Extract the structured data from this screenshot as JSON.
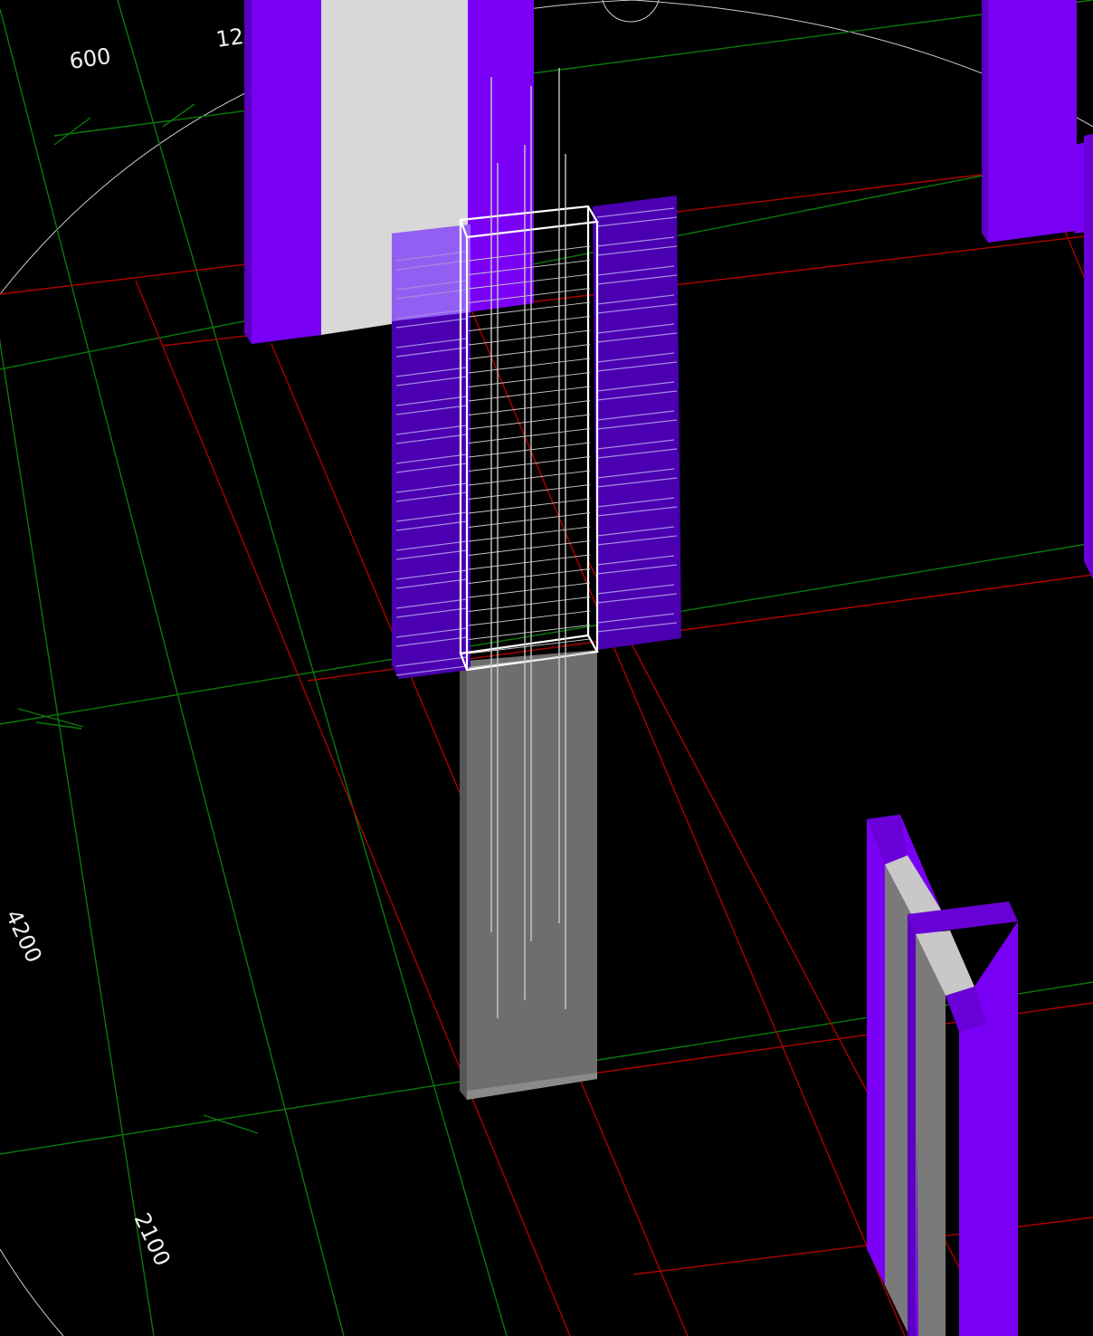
{
  "viewport": {
    "background": "#000000"
  },
  "colors": {
    "axis_grid": "#b00000",
    "span_grid": "#0a7a0a",
    "column_face": "#7a00f5",
    "column_shade": "#5a00c0",
    "column_core": "#d8d8d8",
    "pier": "#6e6e6e",
    "selection": "#ffffff",
    "rebar": "#c9c9c9",
    "tie": "#a48ae0"
  },
  "dimensions": {
    "d600": "600",
    "d12": "12",
    "d4200": "4200",
    "d2100": "2100"
  },
  "icons": {
    "orbit": "orbit-circle-icon"
  }
}
